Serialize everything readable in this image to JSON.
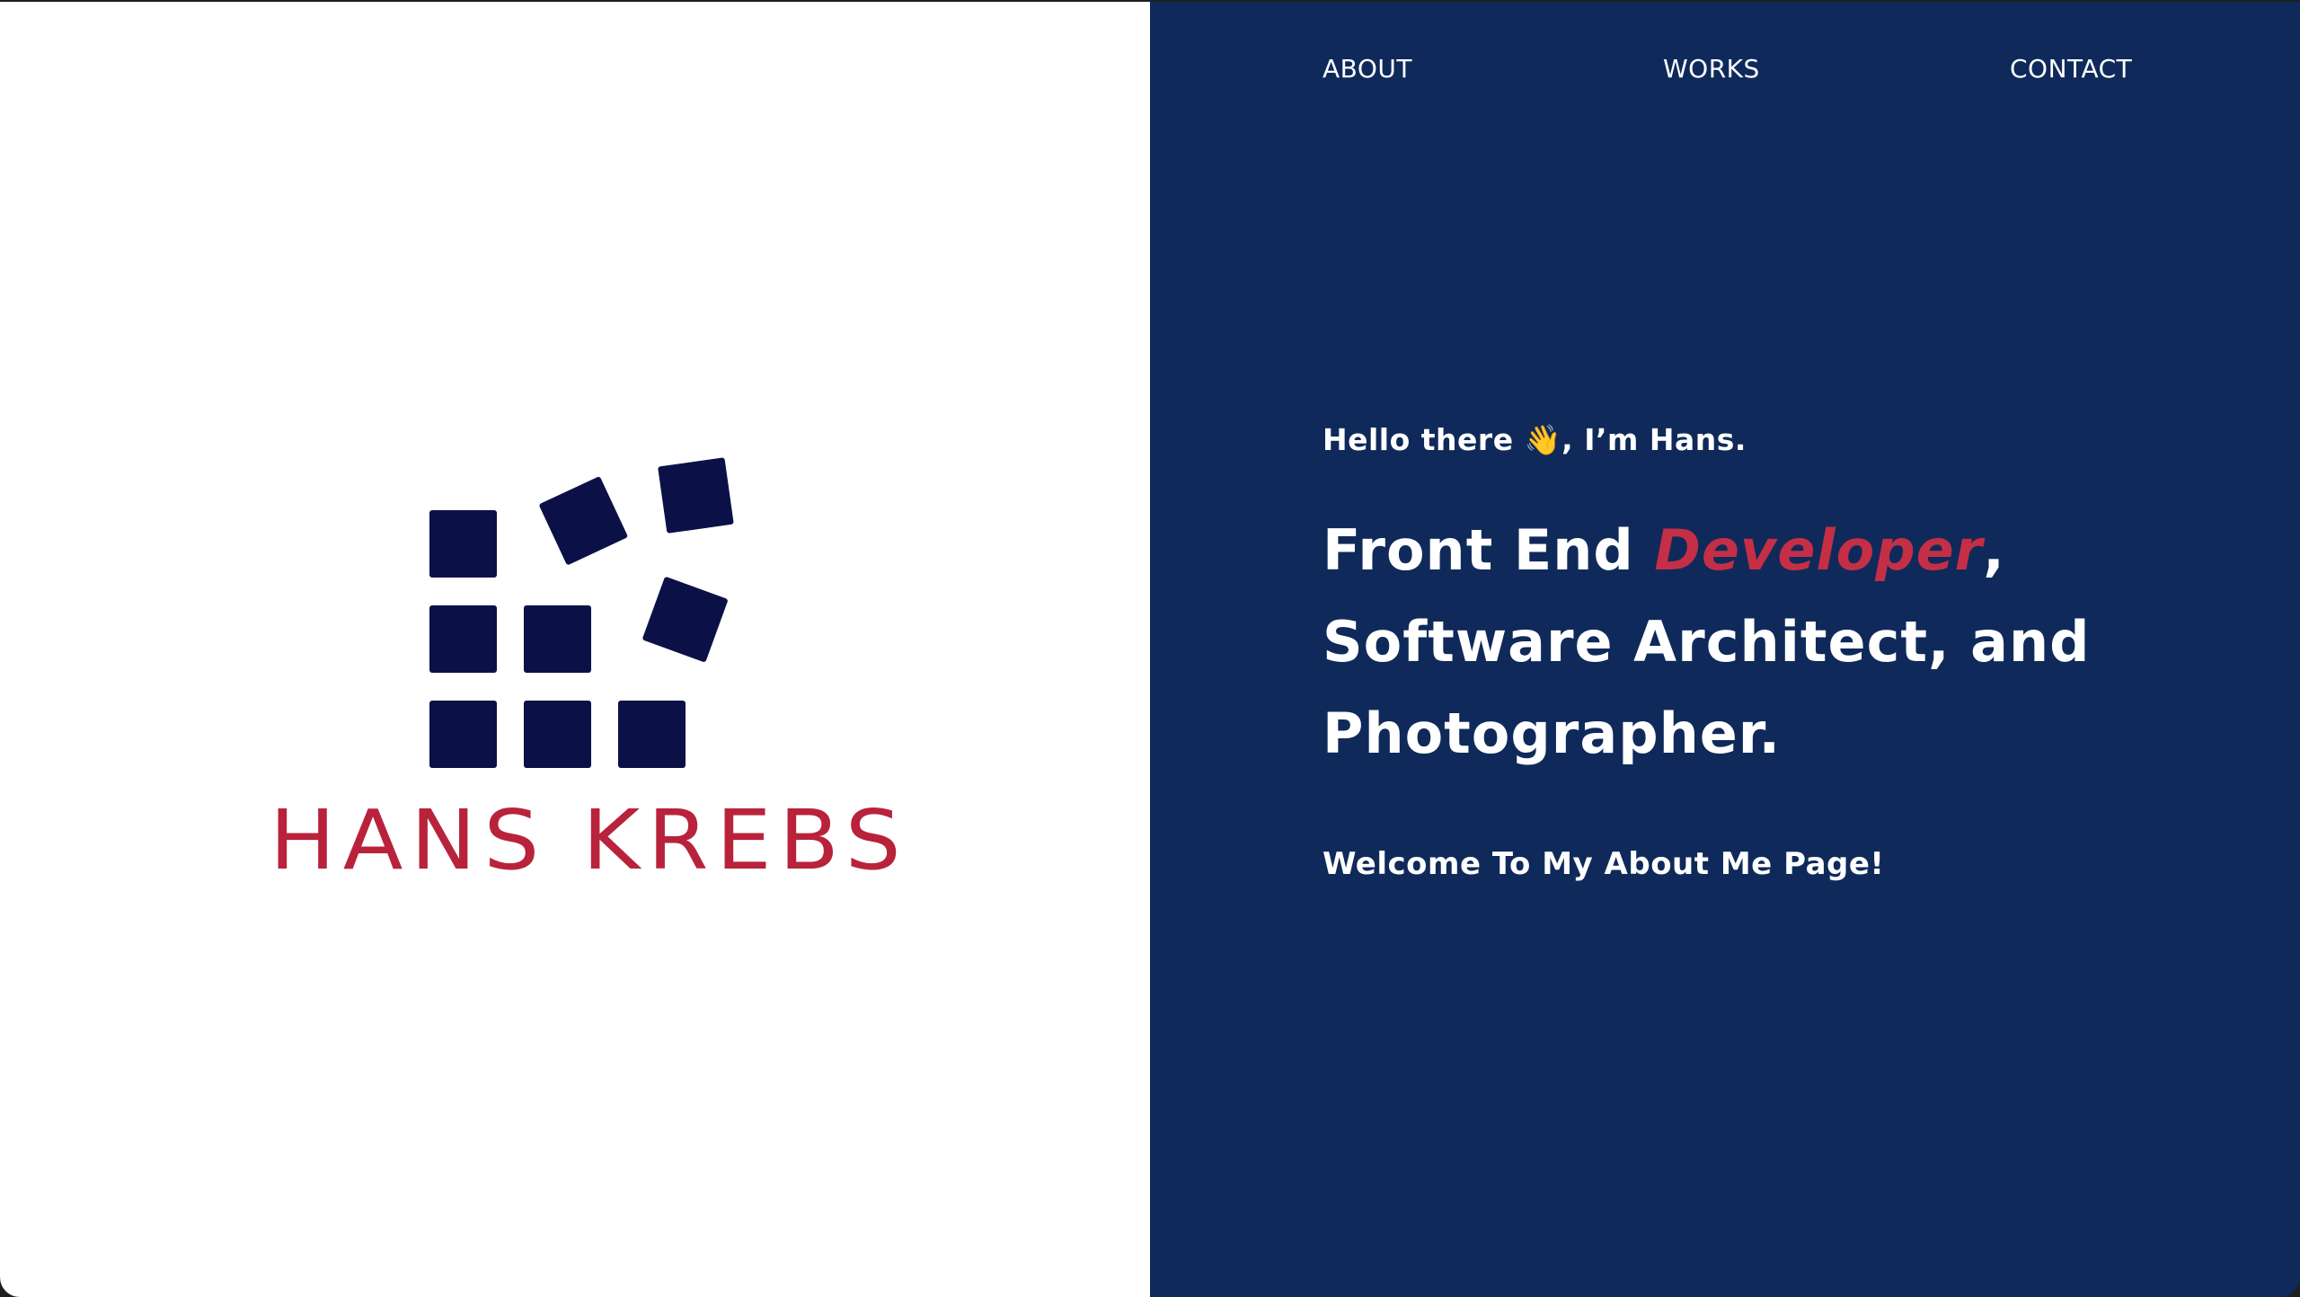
{
  "logo": {
    "name": "HANS KREBS",
    "brand_text_color": "#b8233b",
    "mark_color": "#0b1147"
  },
  "nav": {
    "about": "ABOUT",
    "works": "WORKS",
    "contact": "CONTACT"
  },
  "hero": {
    "greeting": "Hello there 👋, I’m Hans.",
    "headline_part1": "Front End ",
    "headline_accent": "Developer",
    "headline_part2": ",",
    "headline_line2": "Software Architect, and",
    "headline_line3": "Photographer.",
    "welcome": "Welcome To My About Me Page!"
  },
  "colors": {
    "left_background": "#ffffff",
    "right_background": "#0f2a5a",
    "accent": "#c52f46"
  }
}
